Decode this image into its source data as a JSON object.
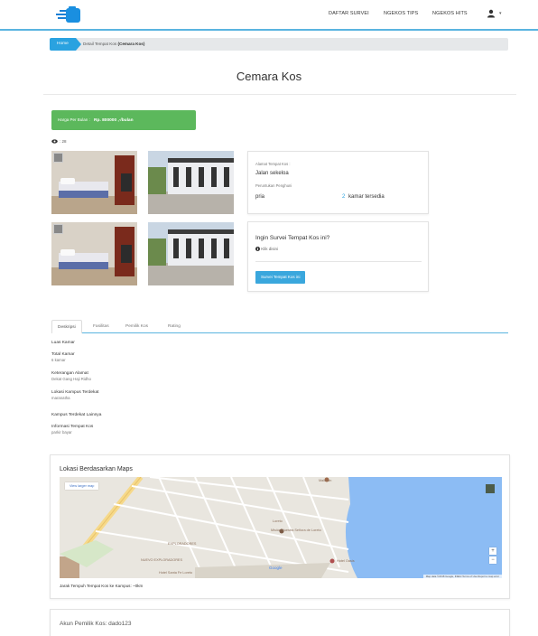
{
  "navbar": {
    "links": [
      "DAFTAR SURVEI",
      "NGEKOS TIPS",
      "NGEKOS HITS"
    ],
    "user_caret": "▾"
  },
  "breadcrumb": {
    "home": "Home",
    "current_prefix": "Detail Tempat Kos",
    "current_name": "(Cemara Kos)"
  },
  "page": {
    "title": "Cemara Kos"
  },
  "price": {
    "label": "Harga Per Bulan :",
    "value": "Rp. 800000 ,-/bulan"
  },
  "views": {
    "count": ": 28"
  },
  "info": {
    "address_label": "Alamat Tempat Kos :",
    "address": "Jalan sekeloa",
    "for_label": "Peruntukan Penghuni",
    "for_value": "pria",
    "rooms_count": "2",
    "rooms_label": "kamar tersedia"
  },
  "survey": {
    "question": "Ingin Survei Tempat Kos ini?",
    "hint": "Klik disini",
    "button": "Survei Tempat Kos ini"
  },
  "tabs": [
    "Deskripsi",
    "Fasilitas",
    "Pemilik Kos",
    "Rating"
  ],
  "description": [
    {
      "heading": "Luas Kamar",
      "value": ""
    },
    {
      "heading": "Total Kamar",
      "value": "6 kamar"
    },
    {
      "heading": "Keterangan Alamat",
      "value": "Dekat Gang Haji Ridho"
    },
    {
      "heading": "Lokasi Kampus Terdekat",
      "value": "maranatha"
    },
    {
      "heading": "Kampus Terdekat Lainnya",
      "value": ""
    },
    {
      "heading": "Informasi Tempat Kos",
      "value": "parkir bayar"
    }
  ],
  "map": {
    "title": "Lokasi Berdasarkan Maps",
    "larger_link": "View larger map",
    "labels": [
      "Loreto",
      "Misión Nuestra Señora de Loreto",
      "EXPLORADORES",
      "NUEVO EXPLORADORES",
      "Hotel Oasis",
      "Hotel Santa Fe Loreto",
      "Malecón"
    ],
    "google": "Google",
    "footer": "Map data ©2018 Google, INEGI   Terms of Use   Report a map error",
    "zoom_in": "+",
    "zoom_out": "−",
    "distance": "Jarak Tempuh Tempat Kos ke Kampus: ~0km"
  },
  "owner": {
    "text": "Akun Pemilik Kos: dado123"
  },
  "colors": {
    "accent": "#2aa2e0",
    "price_green": "#5cb85c",
    "nav_border": "#5ab4e0"
  }
}
